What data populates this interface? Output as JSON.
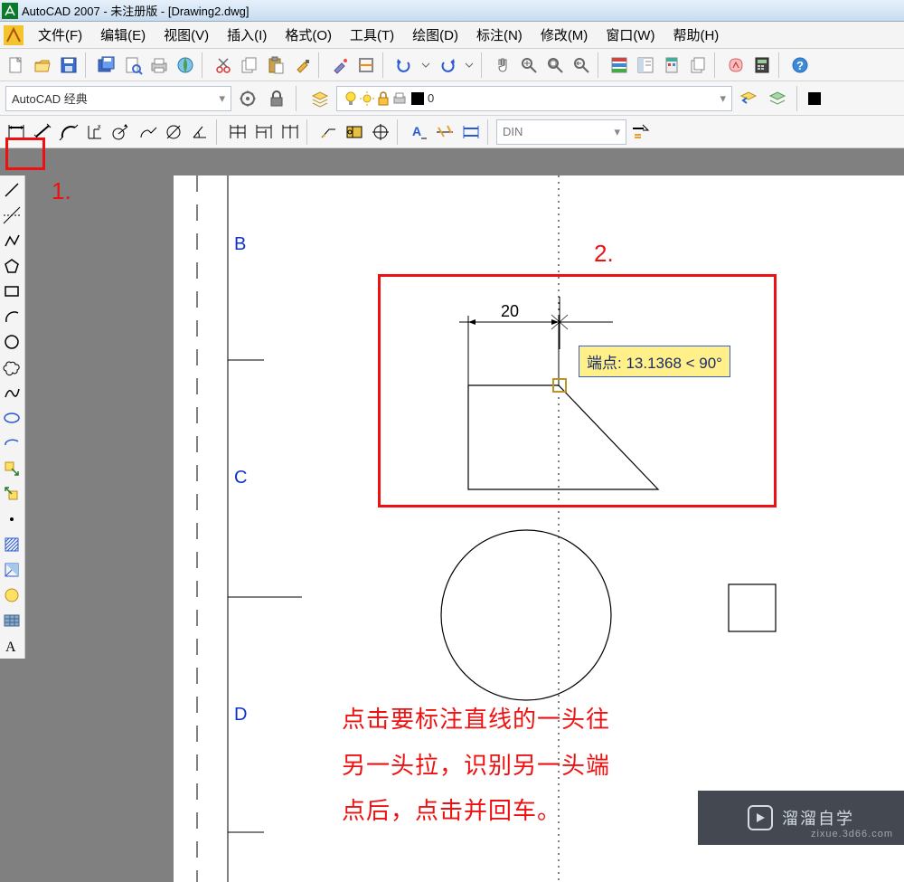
{
  "title": "AutoCAD 2007 - 未注册版 - [Drawing2.dwg]",
  "menu": [
    "文件(F)",
    "编辑(E)",
    "视图(V)",
    "插入(I)",
    "格式(O)",
    "工具(T)",
    "绘图(D)",
    "标注(N)",
    "修改(M)",
    "窗口(W)",
    "帮助(H)"
  ],
  "workspace_combo": "AutoCAD 经典",
  "layer_combo": "0",
  "dim_style_combo": "DIN",
  "annotations": {
    "label1": "1.",
    "label2": "2.",
    "dim_value": "20",
    "tooltip": "端点: 13.1368 < 90°",
    "instruction_l1": "点击要标注直线的一头往",
    "instruction_l2": "另一头拉，识别另一头端",
    "instruction_l3": "点后，点击并回车。"
  },
  "drawing_labels": {
    "B": "B",
    "C": "C",
    "D": "D"
  },
  "watermark": {
    "brand": "溜溜自学",
    "url": "zixue.3d66.com"
  },
  "icons": {
    "new": "new-icon",
    "open": "open-icon",
    "save": "save-icon",
    "saveall": "saveall-icon",
    "printprev": "print-preview-icon",
    "plot": "plot-icon",
    "publish": "publish-icon",
    "cut": "cut-icon",
    "copy": "copy-icon",
    "paste": "paste-icon",
    "match": "match-prop-icon",
    "paint": "paint-icon",
    "undo": "undo-icon",
    "redo": "redo-icon",
    "pan": "pan-icon",
    "zoomin": "zoom-in-icon",
    "zoomout": "zoom-out-icon",
    "zoomwin": "zoom-window-icon",
    "zoomprev": "zoom-prev-icon",
    "props": "properties-icon",
    "dc": "design-center-icon",
    "toolpal": "tool-palettes-icon",
    "sheet": "sheet-set-icon",
    "markup": "markup-icon",
    "calc": "calc-icon",
    "help": "help-icon",
    "gear": "gear-icon",
    "layers": "layer-manager-icon",
    "layer-off": "layer-off-icon",
    "layer-iso": "layer-iso-icon",
    "linear": "dim-linear-icon",
    "aligned": "dim-aligned-icon",
    "arc": "dim-arc-icon",
    "ordinate": "dim-ordinate-icon",
    "radius": "dim-radius-icon",
    "jogged": "dim-jogged-icon",
    "diameter": "dim-diameter-icon",
    "angular": "dim-angular-icon",
    "quick": "dim-quick-icon",
    "baseline": "dim-baseline-icon",
    "continue": "dim-continue-icon",
    "leader": "dim-leader-icon",
    "tolerance": "dim-tolerance-icon",
    "center": "dim-center-icon",
    "dimedit": "dim-edit-text-icon",
    "dimalign": "dim-align-text-icon",
    "dimstyle": "dim-style-icon",
    "dimupdate": "dim-update-icon"
  }
}
